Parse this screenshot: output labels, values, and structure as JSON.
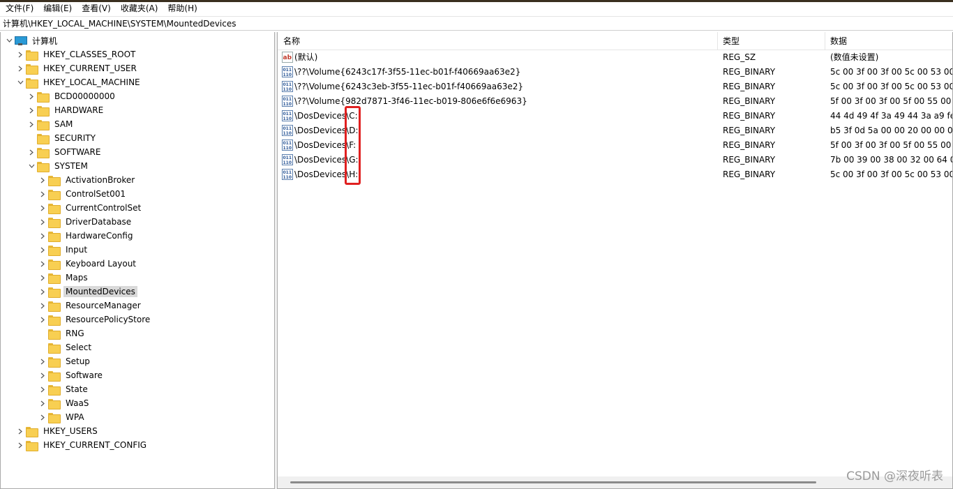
{
  "menubar": {
    "items": [
      "文件(F)",
      "编辑(E)",
      "查看(V)",
      "收藏夹(A)",
      "帮助(H)"
    ]
  },
  "address": "计算机\\HKEY_LOCAL_MACHINE\\SYSTEM\\MountedDevices",
  "tree": {
    "root": "计算机",
    "hives": {
      "classes_root": "HKEY_CLASSES_ROOT",
      "current_user": "HKEY_CURRENT_USER",
      "local_machine": "HKEY_LOCAL_MACHINE",
      "users": "HKEY_USERS",
      "current_config": "HKEY_CURRENT_CONFIG"
    },
    "hklm_children": [
      "BCD00000000",
      "HARDWARE",
      "SAM",
      "SECURITY",
      "SOFTWARE",
      "SYSTEM"
    ],
    "system_children": [
      "ActivationBroker",
      "ControlSet001",
      "CurrentControlSet",
      "DriverDatabase",
      "HardwareConfig",
      "Input",
      "Keyboard Layout",
      "Maps",
      "MountedDevices",
      "ResourceManager",
      "ResourcePolicyStore",
      "RNG",
      "Select",
      "Setup",
      "Software",
      "State",
      "WaaS",
      "WPA"
    ],
    "selected": "MountedDevices"
  },
  "list": {
    "headers": {
      "name": "名称",
      "type": "类型",
      "data": "数据"
    },
    "rows": [
      {
        "icon": "string-value-icon",
        "name": "(默认)",
        "type": "REG_SZ",
        "data": "(数值未设置)"
      },
      {
        "icon": "binary-value-icon",
        "name": "\\??\\Volume{6243c17f-3f55-11ec-b01f-f40669aa63e2}",
        "type": "REG_BINARY",
        "data": "5c 00 3f 00 3f 00 5c 00 53 00 4"
      },
      {
        "icon": "binary-value-icon",
        "name": "\\??\\Volume{6243c3eb-3f55-11ec-b01f-f40669aa63e2}",
        "type": "REG_BINARY",
        "data": "5c 00 3f 00 3f 00 5c 00 53 00 4"
      },
      {
        "icon": "binary-value-icon",
        "name": "\\??\\Volume{982d7871-3f46-11ec-b019-806e6f6e6963}",
        "type": "REG_BINARY",
        "data": "5f 00 3f 00 3f 00 5f 00 55 00 5"
      },
      {
        "icon": "binary-value-icon",
        "name": "\\DosDevices\\C:",
        "type": "REG_BINARY",
        "data": "44 4d 49 4f 3a 49 44 3a a9 fe"
      },
      {
        "icon": "binary-value-icon",
        "name": "\\DosDevices\\D:",
        "type": "REG_BINARY",
        "data": "b5 3f 0d 5a 00 00 20 00 00 00"
      },
      {
        "icon": "binary-value-icon",
        "name": "\\DosDevices\\F:",
        "type": "REG_BINARY",
        "data": "5f 00 3f 00 3f 00 5f 00 55 00 5"
      },
      {
        "icon": "binary-value-icon",
        "name": "\\DosDevices\\G:",
        "type": "REG_BINARY",
        "data": "7b 00 39 00 38 00 32 00 64 00"
      },
      {
        "icon": "binary-value-icon",
        "name": "\\DosDevices\\H:",
        "type": "REG_BINARY",
        "data": "5c 00 3f 00 3f 00 5c 00 53 00 4"
      }
    ]
  },
  "annotation": {
    "color": "#e02020"
  },
  "watermark": "CSDN @深夜听表"
}
